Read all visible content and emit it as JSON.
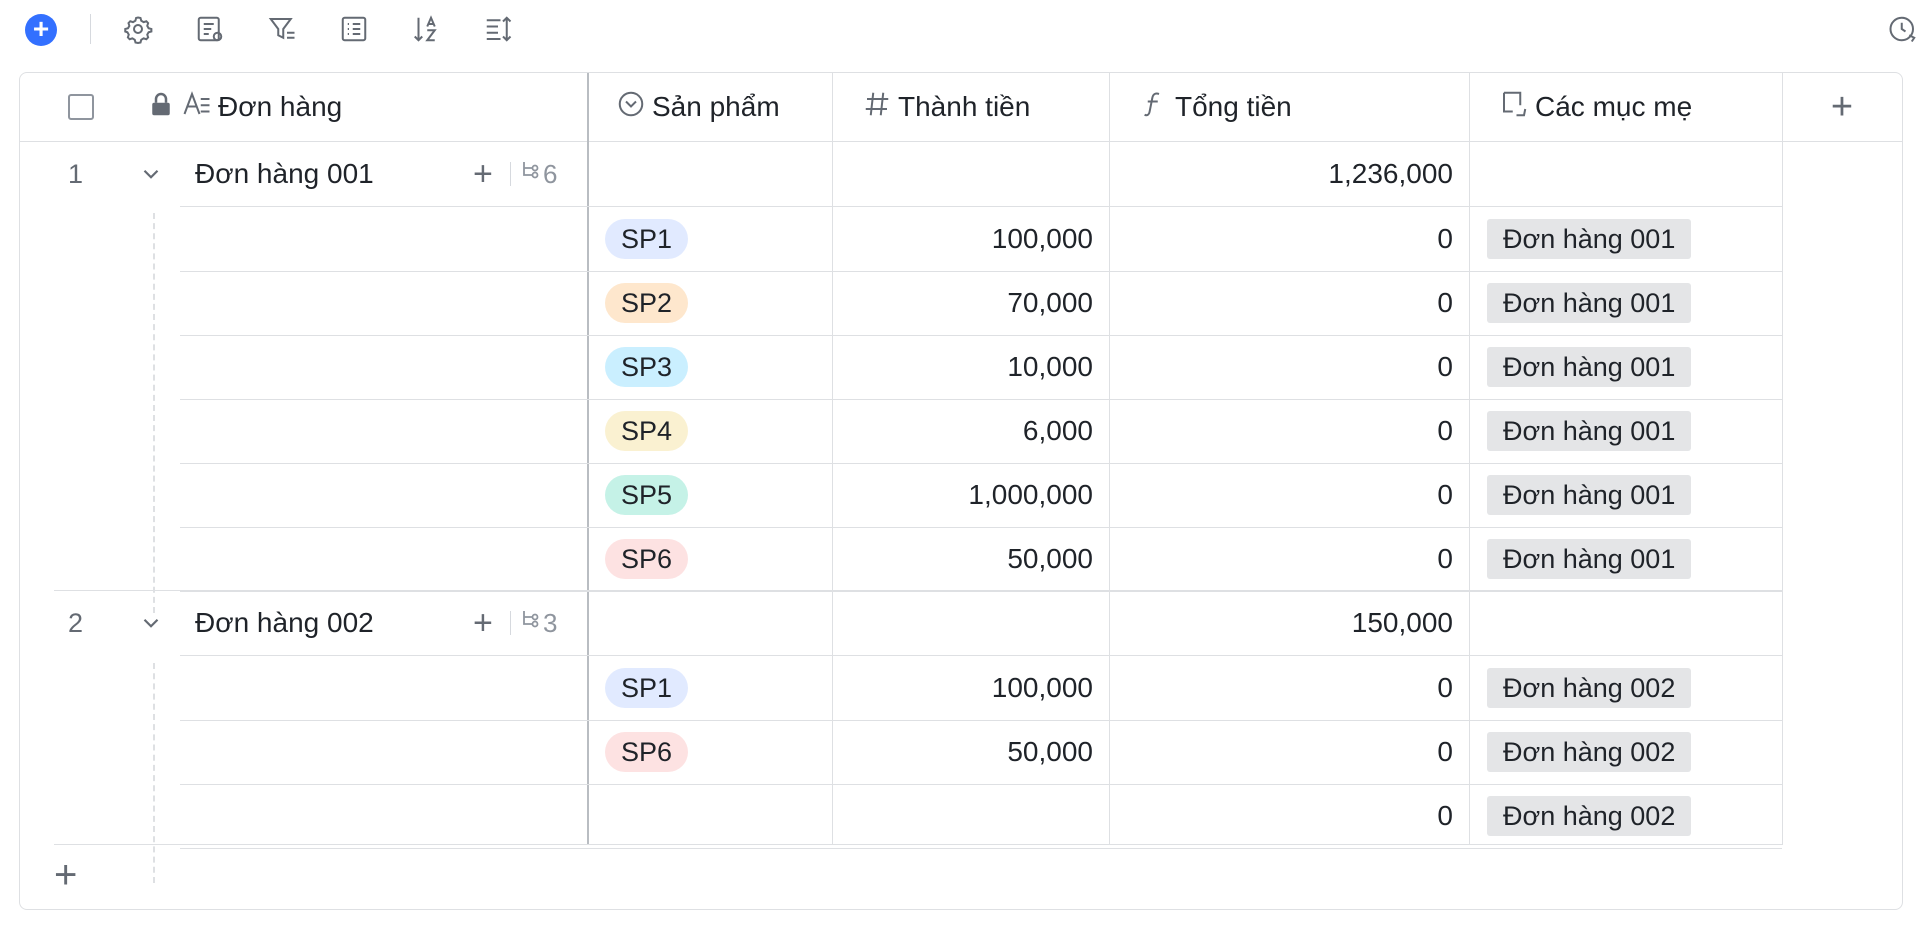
{
  "toolbar": {
    "icons": [
      "add-record-icon",
      "settings-icon",
      "field-config-icon",
      "filter-icon",
      "group-icon",
      "sort-icon",
      "row-height-icon",
      "history-icon"
    ]
  },
  "columns": {
    "primary": "Đơn hàng",
    "product": "Sản phẩm",
    "amount": "Thành tiền",
    "total": "Tổng tiền",
    "parent": "Các mục mẹ"
  },
  "groups": [
    {
      "index": "1",
      "name": "Đơn hàng 001",
      "child_count": "6",
      "total": "1,236,000"
    },
    {
      "index": "2",
      "name": "Đơn hàng 002",
      "child_count": "3",
      "total": "150,000"
    }
  ],
  "children": [
    {
      "product": "SP1",
      "color": "#e1eaff",
      "amount": "100,000",
      "total": "0",
      "parent": "Đơn hàng 001"
    },
    {
      "product": "SP2",
      "color": "#fee7cd",
      "amount": "70,000",
      "total": "0",
      "parent": "Đơn hàng 001"
    },
    {
      "product": "SP3",
      "color": "#caefff",
      "amount": "10,000",
      "total": "0",
      "parent": "Đơn hàng 001"
    },
    {
      "product": "SP4",
      "color": "#faf1d1",
      "amount": "6,000",
      "total": "0",
      "parent": "Đơn hàng 001"
    },
    {
      "product": "SP5",
      "color": "#c5f2e7",
      "amount": "1,000,000",
      "total": "0",
      "parent": "Đơn hàng 001"
    },
    {
      "product": "SP6",
      "color": "#fde2e2",
      "amount": "50,000",
      "total": "0",
      "parent": "Đơn hàng 001"
    },
    {
      "product": "SP1",
      "color": "#e1eaff",
      "amount": "100,000",
      "total": "0",
      "parent": "Đơn hàng 002"
    },
    {
      "product": "SP6",
      "color": "#fde2e2",
      "amount": "50,000",
      "total": "0",
      "parent": "Đơn hàng 002"
    },
    {
      "product": "",
      "color": "",
      "amount": "",
      "total": "0",
      "parent": "Đơn hàng 002"
    }
  ]
}
